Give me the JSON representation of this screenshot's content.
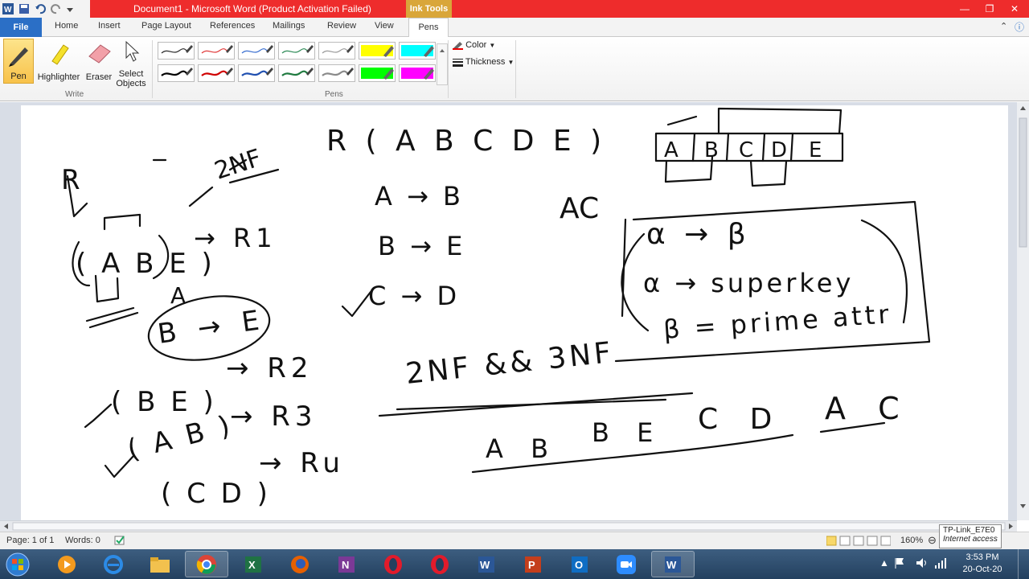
{
  "window": {
    "title": "Document1  -  Microsoft Word (Product Activation Failed)",
    "contextual_tab": "Ink Tools",
    "buttons": [
      "minimize-icon",
      "restore-icon",
      "close-icon"
    ]
  },
  "tabs": {
    "file": "File",
    "items": [
      "Home",
      "Insert",
      "Page Layout",
      "References",
      "Mailings",
      "Review",
      "View"
    ],
    "pens": "Pens"
  },
  "ribbon": {
    "write": {
      "pen": "Pen",
      "highlighter": "Highlighter",
      "eraser": "Eraser",
      "select_line1": "Select",
      "select_line2": "Objects",
      "group_label": "Write"
    },
    "pens": {
      "group_label": "Pens",
      "row1_colors": [
        "#2b2b2b",
        "#e03a3a",
        "#3a6fd0",
        "#2e8b57",
        "#9a9a9a",
        "#ffff00",
        "#00ffff"
      ],
      "row2_colors": [
        "#000000",
        "#d00000",
        "#1f4fb0",
        "#1f7a3f",
        "#8a8a8a",
        "#00ff00",
        "#ff00ff"
      ]
    },
    "color_label": "Color",
    "thickness_label": "Thickness"
  },
  "status": {
    "page": "Page: 1 of 1",
    "words": "Words: 0",
    "zoom": "160%"
  },
  "tooltip": {
    "line1": "TP-Link_E7E0",
    "line2": "Internet access"
  },
  "taskbar": {
    "icons": [
      "start-orb",
      "media-player",
      "internet-explorer",
      "file-explorer",
      "chrome",
      "excel",
      "firefox",
      "onenote",
      "opera",
      "opera",
      "word",
      "powerpoint",
      "outlook",
      "zoom",
      "word"
    ],
    "time": "3:53 PM",
    "date": "20-Oct-20"
  },
  "ink": {
    "r_label": "R",
    "twonf": "2NF",
    "relation": "R ( A B C D E )",
    "fd1": "A → B",
    "fd2": "B → E",
    "fd3": "C → D",
    "ac": "AC",
    "abe": "( A B E )",
    "r1": "→ R1",
    "a_small": "A",
    "b_to_e": "B → E",
    "r2": "→ R2",
    "be": "( B E )",
    "r3": "→ R3",
    "ab": "( A B )",
    "r4": "→ Ru",
    "cd": "( C D )",
    "box_alpha_beta": "α → β",
    "box_superkey": "α → superkey",
    "box_prime": "β = prime attr",
    "nf_compare": "2NF && 3NF",
    "result_ab": "A B",
    "result_be": "B E",
    "result_cd": "C D",
    "result_ac": "A C",
    "table_cells": [
      "A",
      "B",
      "C",
      "D",
      "E"
    ]
  }
}
